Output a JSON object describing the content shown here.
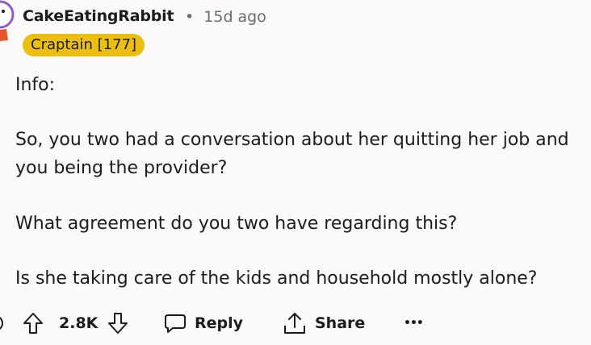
{
  "comment": {
    "author": "CakeEatingRabbit",
    "separator": "•",
    "time_ago": "15d ago",
    "flair": "Craptain [177]",
    "paragraphs": [
      "Info:",
      "So, you two had a conversation about her quitting her job and you being the provider?",
      "What agreement do you two have regarding this?",
      "Is she taking care of the kids and household mostly alone?"
    ]
  },
  "actions": {
    "score": "2.8K",
    "reply_label": "Reply",
    "share_label": "Share",
    "more_label": "•••"
  },
  "colors": {
    "background": "#fbfaf9",
    "flair_bg": "#ecbe12",
    "meta_text": "#6a6d70",
    "avatar_purple": "#8a5fbf",
    "avatar_orange": "#e8552b"
  },
  "icons": [
    "avatar",
    "upvote-icon",
    "downvote-icon",
    "reply-icon",
    "share-icon",
    "more-icon"
  ]
}
